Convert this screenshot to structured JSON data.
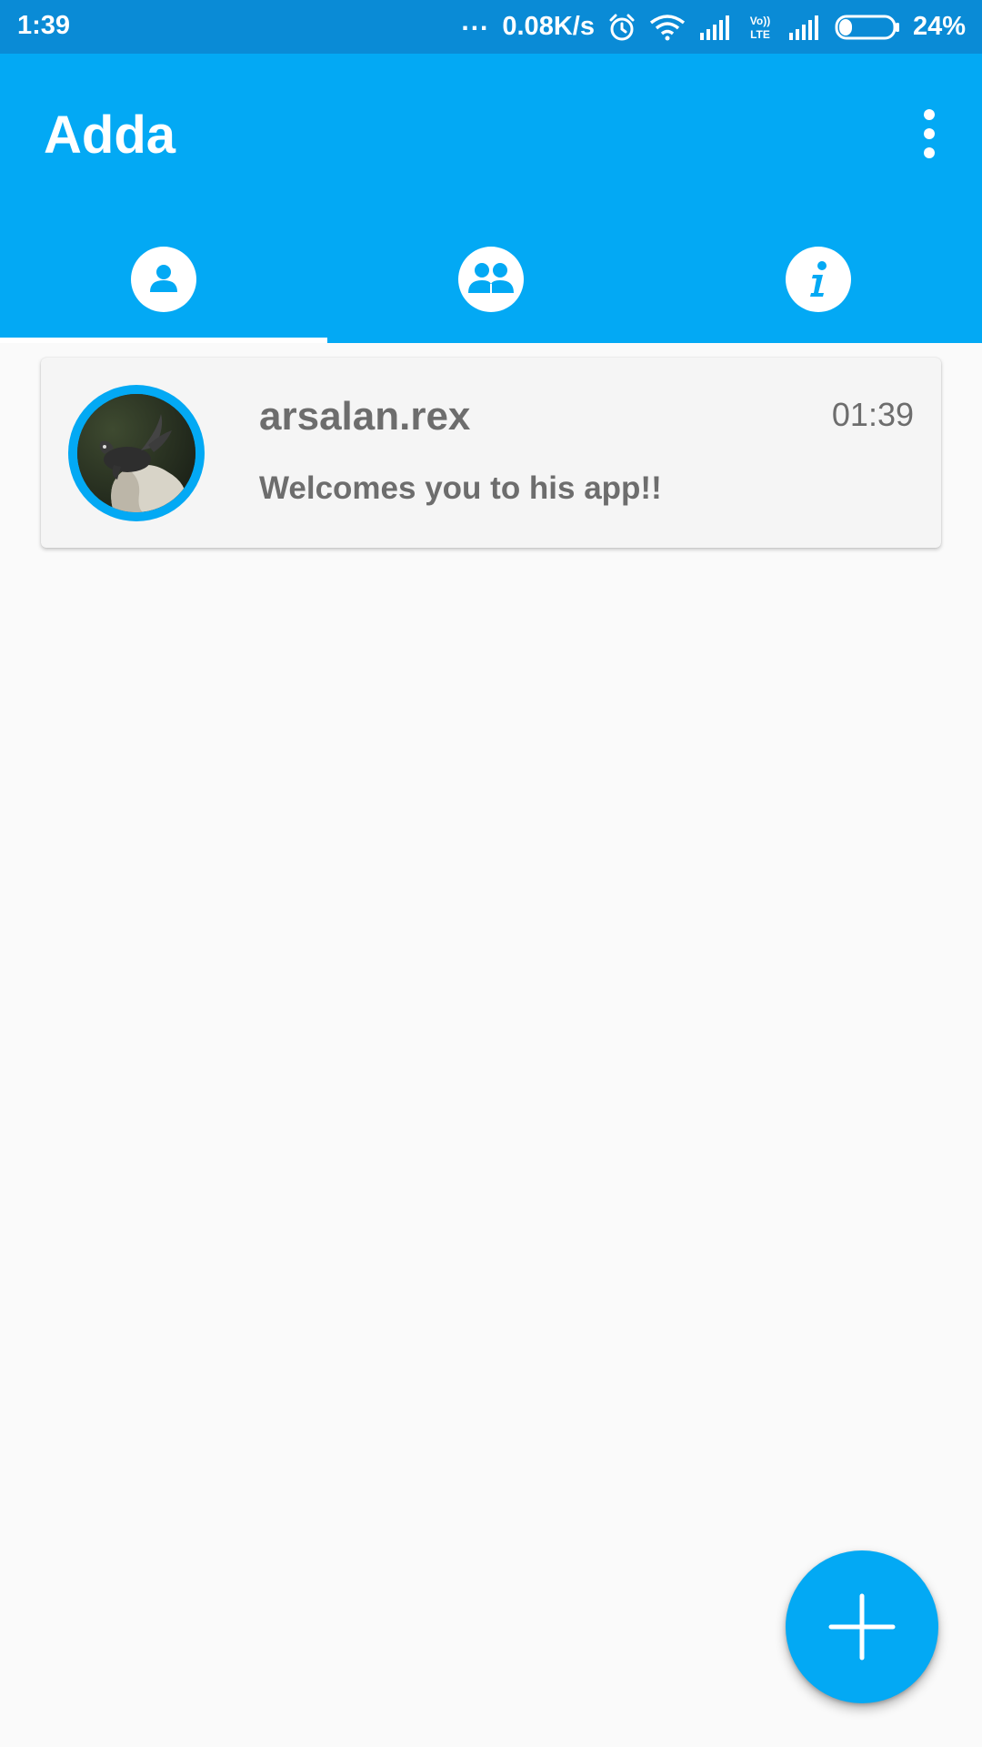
{
  "status_bar": {
    "time": "1:39",
    "dots": "...",
    "network_speed": "0.08K/s",
    "volte_label": "Vo)) LTE",
    "battery_percent": "24%",
    "battery_level": 0.24,
    "icons": [
      "alarm-icon",
      "wifi-icon",
      "signal-icon",
      "volte-icon",
      "signal-icon",
      "battery-icon"
    ]
  },
  "app_bar": {
    "title": "Adda",
    "menu_icon": "overflow-menu-icon"
  },
  "tabs": [
    {
      "id": "chats",
      "icon": "person-icon",
      "selected": true
    },
    {
      "id": "groups",
      "icon": "group-icon",
      "selected": false
    },
    {
      "id": "info",
      "icon": "info-icon",
      "selected": false
    }
  ],
  "chats": [
    {
      "name": "arsalan.rex",
      "time": "01:39",
      "message": "Welcomes you to his app!!",
      "avatar": "turtle-avatar"
    }
  ],
  "fab": {
    "icon": "plus-icon"
  },
  "colors": {
    "primary": "#03a9f4",
    "status_bar": "#0a8bd6",
    "background": "#fafafa",
    "card": "#f5f5f5",
    "text_secondary": "#6d6d6d"
  }
}
